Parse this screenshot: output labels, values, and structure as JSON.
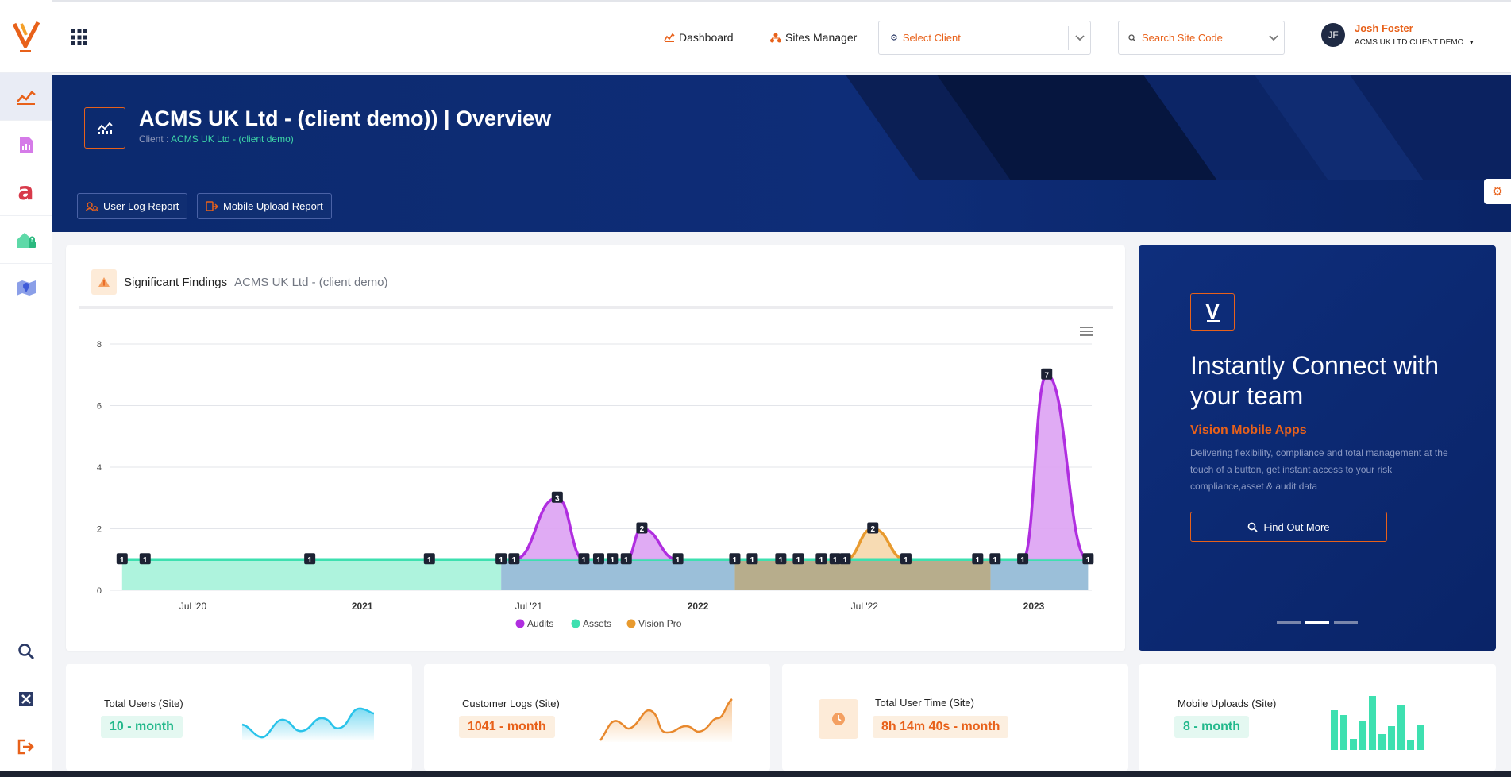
{
  "nav": {
    "dashboard": "Dashboard",
    "sites_manager": "Sites Manager",
    "client_select_placeholder": "Select Client",
    "site_search_placeholder": "Search Site Code"
  },
  "user": {
    "initials": "JF",
    "name": "Josh Foster",
    "org": "ACMS UK LTD CLIENT DEMO"
  },
  "header": {
    "title": "ACMS UK Ltd - (client demo)) | Overview",
    "client_label": "Client :",
    "client_name": "ACMS UK Ltd - (client demo)",
    "buttons": [
      "User Log Report",
      "Mobile Upload Report"
    ]
  },
  "findings": {
    "title": "Significant Findings",
    "subtitle": "ACMS UK Ltd - (client demo)"
  },
  "chart_data": {
    "type": "area",
    "y_ticks": [
      "0",
      "2",
      "4",
      "6",
      "8"
    ],
    "ylim": [
      0,
      8
    ],
    "x_ticks": [
      "Jul '20",
      "2021",
      "Jul '21",
      "2022",
      "Jul '22",
      "2023"
    ],
    "legend": [
      "Audits",
      "Assets",
      "Vision Pro"
    ],
    "legend_position": "bottom",
    "colors": {
      "Audits": "#b02ee0",
      "Assets": "#3ee0b0",
      "Vision Pro": "#e89a2e"
    },
    "series": [
      {
        "name": "Audits",
        "points": [
          {
            "x": "2021-06-15",
            "y": 1,
            "label": "1"
          },
          {
            "x": "2021-08-01",
            "y": 3,
            "label": "3"
          },
          {
            "x": "2021-08-30",
            "y": 1,
            "label": "1"
          },
          {
            "x": "2021-09-15",
            "y": 1,
            "label": "1"
          },
          {
            "x": "2021-09-30",
            "y": 1,
            "label": "1"
          },
          {
            "x": "2021-10-15",
            "y": 1,
            "label": "1"
          },
          {
            "x": "2021-11-01",
            "y": 2,
            "label": "2"
          },
          {
            "x": "2021-12-10",
            "y": 1,
            "label": "1"
          },
          {
            "x": "2022-11-20",
            "y": 1,
            "label": "1"
          },
          {
            "x": "2022-12-20",
            "y": 1,
            "label": "1"
          },
          {
            "x": "2023-01-15",
            "y": 7,
            "label": "7"
          },
          {
            "x": "2023-03-01",
            "y": 1,
            "label": "1"
          }
        ]
      },
      {
        "name": "Assets",
        "points": [
          {
            "x": "2020-04-15",
            "y": 1,
            "label": "1"
          },
          {
            "x": "2020-05-10",
            "y": 1,
            "label": "1"
          },
          {
            "x": "2020-11-05",
            "y": 1,
            "label": "1"
          },
          {
            "x": "2021-03-15",
            "y": 1,
            "label": "1"
          },
          {
            "x": "2021-06-01",
            "y": 1,
            "label": "1"
          }
        ]
      },
      {
        "name": "Vision Pro",
        "points": [
          {
            "x": "2022-02-10",
            "y": 1,
            "label": "1"
          },
          {
            "x": "2022-03-01",
            "y": 1,
            "label": "1"
          },
          {
            "x": "2022-04-01",
            "y": 1,
            "label": "1"
          },
          {
            "x": "2022-04-20",
            "y": 1,
            "label": "1"
          },
          {
            "x": "2022-05-15",
            "y": 1,
            "label": "1"
          },
          {
            "x": "2022-05-30",
            "y": 1,
            "label": "1"
          },
          {
            "x": "2022-06-10",
            "y": 1,
            "label": "1"
          },
          {
            "x": "2022-07-10",
            "y": 2,
            "label": "2"
          },
          {
            "x": "2022-08-15",
            "y": 1,
            "label": "1"
          },
          {
            "x": "2022-11-01",
            "y": 1,
            "label": "1"
          }
        ]
      }
    ]
  },
  "promo": {
    "logo": "V",
    "title": "Instantly Connect with your team",
    "subtitle": "Vision Mobile Apps",
    "text": "Delivering flexibility, compliance and total management at the touch of a button, get instant access to your risk compliance,asset & audit data",
    "button": "Find Out More"
  },
  "stats": [
    {
      "label": "Total Users (Site)",
      "value": "10 - month"
    },
    {
      "label": "Customer Logs (Site)",
      "value": "1041 - month"
    },
    {
      "label": "Total User Time (Site)",
      "value": "8h 14m 40s - month"
    },
    {
      "label": "Mobile Uploads (Site)",
      "value": "8 - month"
    }
  ],
  "sidebar_icons": [
    "trend-chart-icon",
    "document-chart-icon",
    "letter-a-icon",
    "home-lock-icon",
    "map-pin-icon"
  ],
  "sidebar_bottom_icons": [
    "search-icon",
    "close-box-icon",
    "logout-icon"
  ]
}
